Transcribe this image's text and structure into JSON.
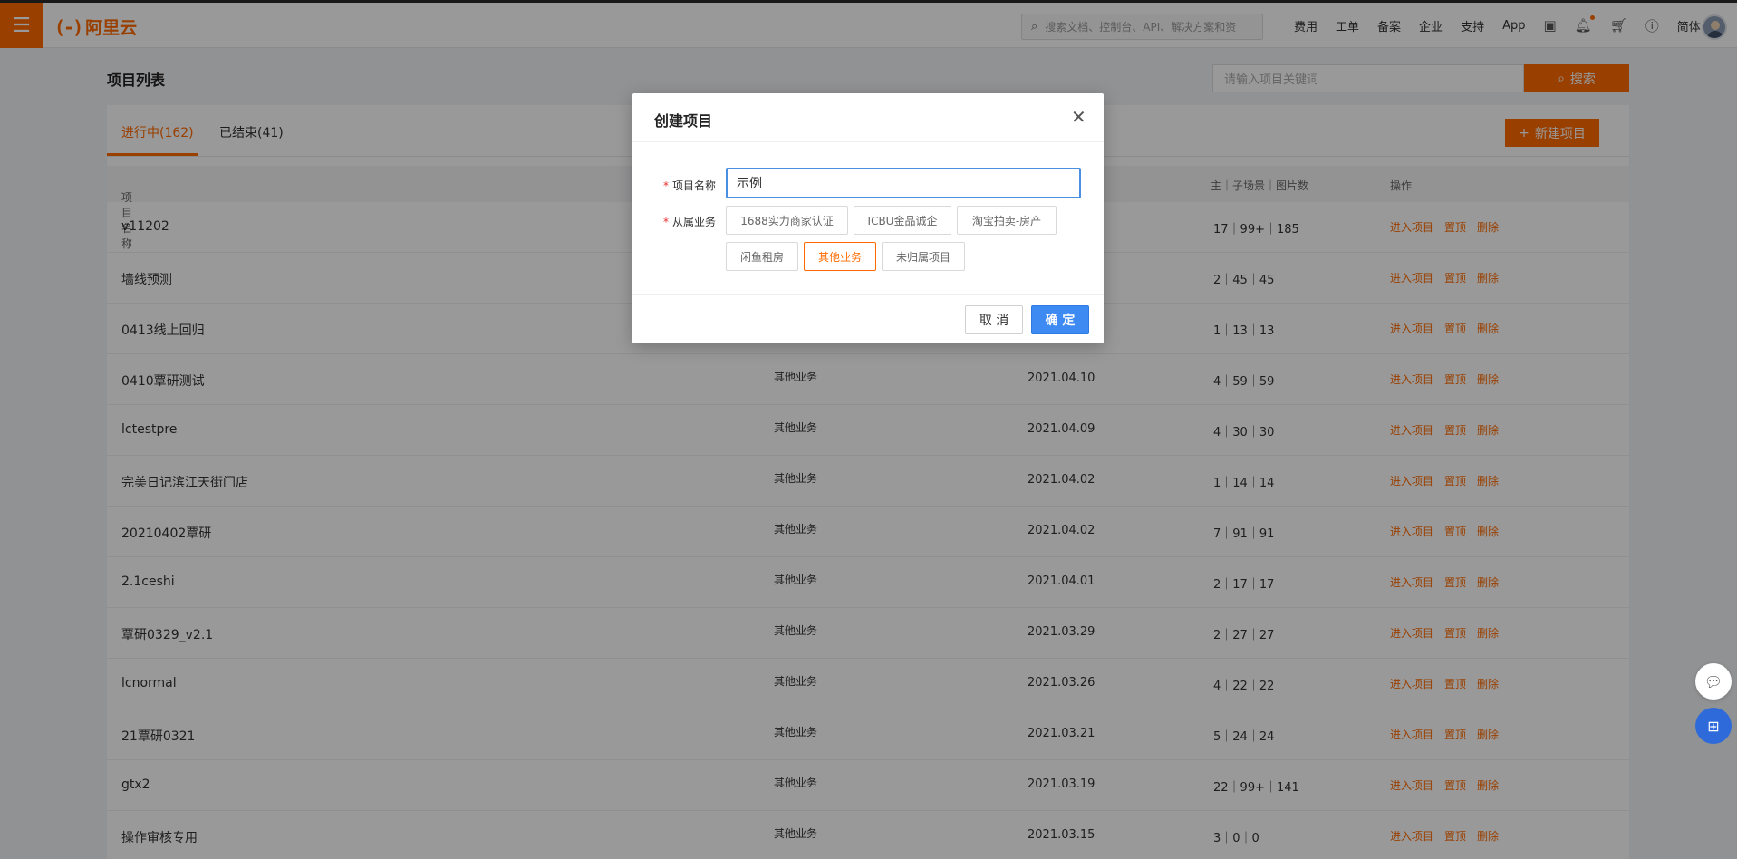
{
  "topnav": {
    "menu_icon": "menu-icon",
    "logo_text": "阿里云",
    "search_placeholder": "搜索文档、控制台、API、解决方案和资",
    "links": [
      "费用",
      "工单",
      "备案",
      "企业",
      "支持",
      "App"
    ],
    "lang": "简体",
    "icons": [
      "terminal-icon",
      "bell-icon",
      "cart-icon",
      "help-icon"
    ]
  },
  "page": {
    "title": "项目列表",
    "keyword_placeholder": "请输入项目关键词",
    "search_button": "搜索",
    "new_project_button": "新建项目"
  },
  "tabs": [
    {
      "label": "进行中(162)",
      "active": true
    },
    {
      "label": "已结束(41)",
      "active": false
    }
  ],
  "table": {
    "headers": {
      "name": "项目名称",
      "counts": "主｜子场景｜图片数",
      "ops": "操作"
    },
    "ops": {
      "enter": "进入项目",
      "top": "置顶",
      "delete": "删除"
    },
    "rows": [
      {
        "name": "v11202",
        "biz": "",
        "date": "",
        "counts": "17｜99+｜185"
      },
      {
        "name": "墙线预测",
        "biz": "",
        "date": "",
        "counts": "2｜45｜45"
      },
      {
        "name": "0413线上回归",
        "biz": "",
        "date": "",
        "counts": "1｜13｜13"
      },
      {
        "name": "0410覃研测试",
        "biz": "其他业务",
        "date": "2021.04.10",
        "counts": "4｜59｜59"
      },
      {
        "name": "lctestpre",
        "biz": "其他业务",
        "date": "2021.04.09",
        "counts": "4｜30｜30"
      },
      {
        "name": "完美日记滨江天街门店",
        "biz": "其他业务",
        "date": "2021.04.02",
        "counts": "1｜14｜14"
      },
      {
        "name": "20210402覃研",
        "biz": "其他业务",
        "date": "2021.04.02",
        "counts": "7｜91｜91"
      },
      {
        "name": "2.1ceshi",
        "biz": "其他业务",
        "date": "2021.04.01",
        "counts": "2｜17｜17"
      },
      {
        "name": "覃研0329_v2.1",
        "biz": "其他业务",
        "date": "2021.03.29",
        "counts": "2｜27｜27"
      },
      {
        "name": "lcnormal",
        "biz": "其他业务",
        "date": "2021.03.26",
        "counts": "4｜22｜22"
      },
      {
        "name": "21覃研0321",
        "biz": "其他业务",
        "date": "2021.03.21",
        "counts": "5｜24｜24"
      },
      {
        "name": "gtx2",
        "biz": "其他业务",
        "date": "2021.03.19",
        "counts": "22｜99+｜141"
      },
      {
        "name": "操作审核专用",
        "biz": "其他业务",
        "date": "2021.03.15",
        "counts": "3｜0｜0"
      }
    ]
  },
  "modal": {
    "title": "创建项目",
    "name_label": "项目名称",
    "name_value": "示例",
    "biz_label": "从属业务",
    "biz_options": [
      {
        "label": "1688实力商家认证",
        "selected": false
      },
      {
        "label": "ICBU金品诚企",
        "selected": false
      },
      {
        "label": "淘宝拍卖-房产",
        "selected": false
      },
      {
        "label": "闲鱼租房",
        "selected": false
      },
      {
        "label": "其他业务",
        "selected": true
      },
      {
        "label": "未归属项目",
        "selected": false
      }
    ],
    "cancel_button": "取 消",
    "ok_button": "确 定"
  },
  "colors": {
    "brand_orange": "#ff6a00",
    "primary_blue": "#3d8bf2",
    "required_red": "#e62e2e"
  }
}
